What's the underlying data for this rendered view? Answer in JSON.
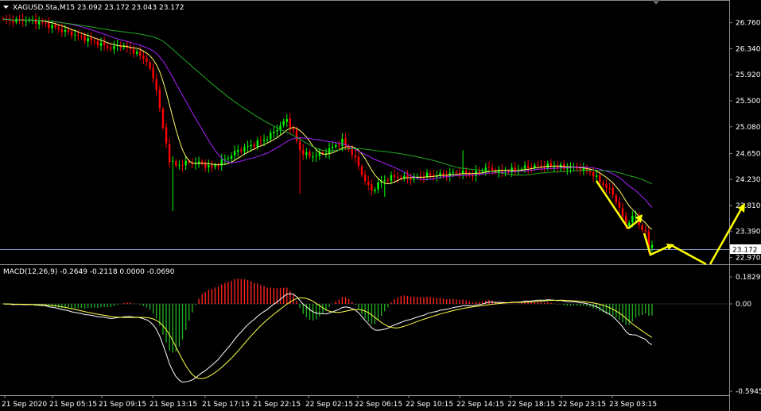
{
  "header": {
    "symbol_line": "XAGUSD.Sta,M15  23.092 23.172 23.043 23.172",
    "macd_line": "MACD(12,26,9) -0.2649 -0.2118 0.0000 -0.0690"
  },
  "colors": {
    "background": "#000000",
    "bull": "#00ff00",
    "bear": "#ff0000",
    "ma_fast": "#ffff66",
    "ma_mid": "#aa22ff",
    "ma_slow": "#22aa22",
    "macd_main": "#ffffff",
    "macd_signal": "#ffff44",
    "hist_pos": "#ff2222",
    "hist_neg": "#22aa22",
    "arrow": "#ffff00",
    "price_line": "#7f8fbf"
  },
  "chart_data": [
    {
      "type": "candlestick",
      "title": "XAGUSD.Sta,M15",
      "last_price": "23.172",
      "ylim": [
        22.9,
        27.05
      ],
      "y_ticks": [
        "26.760",
        "26.340",
        "25.920",
        "25.500",
        "25.080",
        "24.650",
        "24.230",
        "23.810",
        "23.390",
        "22.970"
      ],
      "x_ticks": [
        "21 Sep 2020",
        "21 Sep 05:15",
        "21 Sep 09:15",
        "21 Sep 13:15",
        "21 Sep 17:15",
        "21 Sep 22:15",
        "22 Sep 02:15",
        "22 Sep 06:15",
        "22 Sep 10:15",
        "22 Sep 14:15",
        "22 Sep 18:15",
        "22 Sep 23:15",
        "23 Sep 03:15"
      ],
      "close_anchors": [
        [
          0,
          26.8
        ],
        [
          8,
          26.8
        ],
        [
          12,
          26.76
        ],
        [
          20,
          26.6
        ],
        [
          28,
          26.45
        ],
        [
          33,
          26.35
        ],
        [
          36,
          26.4
        ],
        [
          40,
          26.3
        ],
        [
          44,
          26.15
        ],
        [
          47,
          25.7
        ],
        [
          49,
          25.05
        ],
        [
          51,
          24.55
        ],
        [
          53,
          24.45
        ],
        [
          56,
          24.5
        ],
        [
          60,
          24.5
        ],
        [
          64,
          24.42
        ],
        [
          68,
          24.55
        ],
        [
          72,
          24.7
        ],
        [
          77,
          24.8
        ],
        [
          81,
          24.9
        ],
        [
          84,
          25.05
        ],
        [
          87,
          25.2
        ],
        [
          89,
          25.0
        ],
        [
          91,
          24.7
        ],
        [
          94,
          24.6
        ],
        [
          98,
          24.65
        ],
        [
          101,
          24.75
        ],
        [
          104,
          24.85
        ],
        [
          107,
          24.65
        ],
        [
          109,
          24.45
        ],
        [
          111,
          24.2
        ],
        [
          113,
          24.05
        ],
        [
          116,
          24.2
        ],
        [
          120,
          24.28
        ],
        [
          125,
          24.25
        ],
        [
          130,
          24.3
        ],
        [
          135,
          24.3
        ],
        [
          140,
          24.35
        ],
        [
          144,
          24.3
        ],
        [
          148,
          24.42
        ],
        [
          152,
          24.35
        ],
        [
          156,
          24.38
        ],
        [
          160,
          24.42
        ],
        [
          164,
          24.45
        ],
        [
          168,
          24.45
        ],
        [
          172,
          24.42
        ],
        [
          176,
          24.42
        ],
        [
          180,
          24.35
        ],
        [
          184,
          24.15
        ],
        [
          187,
          24.0
        ],
        [
          189,
          23.75
        ],
        [
          191,
          23.5
        ],
        [
          192,
          23.55
        ],
        [
          194,
          23.65
        ],
        [
          195,
          23.5
        ],
        [
          197,
          23.35
        ],
        [
          198,
          23.15
        ],
        [
          199,
          23.172
        ]
      ],
      "moving_averages": [
        {
          "name": "fast",
          "period": 8
        },
        {
          "name": "mid",
          "period": 20
        },
        {
          "name": "slow",
          "period": 50
        }
      ]
    },
    {
      "type": "macd",
      "title": "MACD(12,26,9)",
      "values": {
        "main": -0.2649,
        "signal": -0.2118,
        "third": 0.0,
        "hist": -0.069
      },
      "ylim": [
        -0.6,
        0.2
      ],
      "y_ticks": [
        "0.1829",
        "0.00",
        "-0.5945"
      ]
    }
  ]
}
